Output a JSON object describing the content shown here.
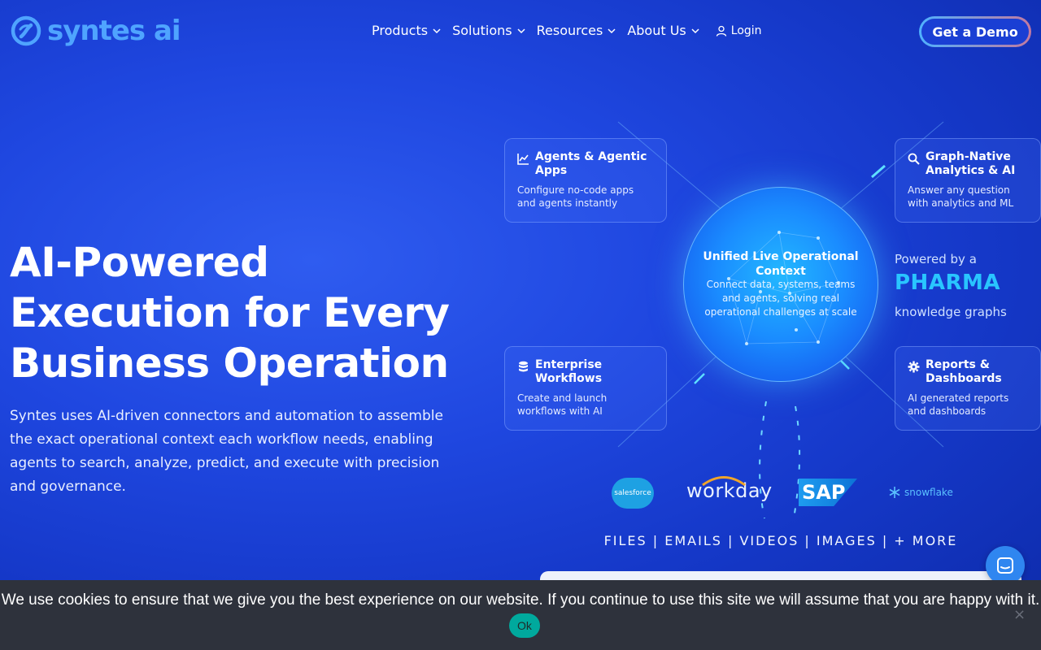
{
  "header": {
    "logo_text": "syntes ai",
    "nav": [
      {
        "label": "Products"
      },
      {
        "label": "Solutions"
      },
      {
        "label": "Resources"
      },
      {
        "label": "About Us"
      }
    ],
    "login_label": "Login",
    "demo_label": "Get a Demo"
  },
  "hero": {
    "title": "AI-Powered Execution for Every Business Operation",
    "description": "Syntes uses AI-driven connectors and automation to assemble the exact operational context each workflow needs, enabling agents to search, analyze, predict, and execute with precision and governance."
  },
  "diagram": {
    "cards": [
      {
        "title": "Agents & Agentic Apps",
        "desc": "Configure no-code apps and agents instantly",
        "icon": "line-chart-icon"
      },
      {
        "title": "Graph-Native Analytics & AI",
        "desc": "Answer any question with analytics and ML",
        "icon": "search-icon"
      },
      {
        "title": "Enterprise Workflows",
        "desc": "Create and launch workflows with AI",
        "icon": "database-icon"
      },
      {
        "title": "Reports & Dashboards",
        "desc": "AI generated reports and dashboards",
        "icon": "gear-icon"
      }
    ],
    "center_title": "Unified Live Operational Context",
    "center_desc": "Connect data, systems, teams and agents, solving real operational challenges at scale",
    "powered_line1": "Powered by a",
    "powered_line2": "PHARMA",
    "powered_line3": "knowledge graphs",
    "brands": {
      "salesforce": "salesforce",
      "workday": "workday",
      "sap": "SAP",
      "snowflake": "snowflake"
    },
    "formats": "FILES | EMAILS | VIDEOS | IMAGES | + MORE"
  },
  "cookie": {
    "text": "We use cookies to ensure that we give you the best experience on our website. If you continue to use this site we will assume that you are happy with it.",
    "ok_label": "Ok",
    "close_label": "×"
  },
  "colors": {
    "background": "#1f47e0",
    "logo": "#4fa4ff",
    "accent": "#29c5ff",
    "cookie_bar": "#2e323c",
    "cookie_ok": "#00a99d"
  }
}
